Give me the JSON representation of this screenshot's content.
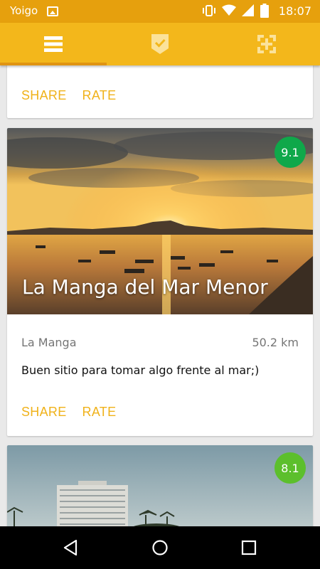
{
  "status_bar": {
    "carrier": "Yoigo",
    "time": "18:07",
    "icons": [
      "gallery-icon",
      "vibrate-icon",
      "wifi-icon",
      "signal-icon",
      "battery-icon"
    ]
  },
  "tabs": [
    {
      "icon": "list-icon",
      "selected": true
    },
    {
      "icon": "badge-check-icon",
      "selected": false
    },
    {
      "icon": "locate-icon",
      "selected": false
    }
  ],
  "colors": {
    "status_bar": "#e6a00d",
    "tab_bar": "#f3b71b",
    "accent": "#f0b21a",
    "rating_dark_green": "#0fa84a",
    "rating_light_green": "#5cbf2c"
  },
  "cards": [
    {
      "share_label": "SHARE",
      "rate_label": "RATE"
    },
    {
      "rating": "9.1",
      "title": "La Manga del Mar Menor",
      "location": "La Manga",
      "distance": "50.2 km",
      "comment": "Buen sitio para tomar algo frente al mar;)",
      "share_label": "SHARE",
      "rate_label": "RATE"
    },
    {
      "rating": "8.1"
    }
  ],
  "nav_bar": {
    "icons": [
      "back-icon",
      "home-icon",
      "recents-icon"
    ]
  }
}
